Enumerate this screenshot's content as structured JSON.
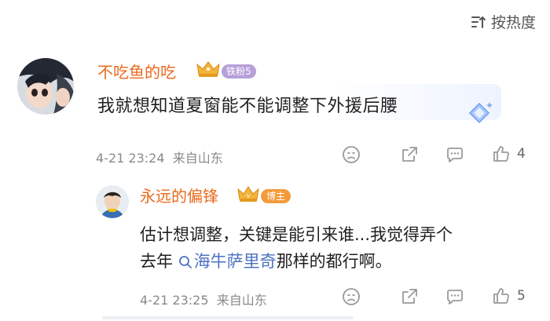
{
  "sort": {
    "label": "按热度",
    "icon": "sort-icon"
  },
  "comment": {
    "username": "不吃鱼的吃",
    "fan_badge": "铁粉5",
    "text": "我就想知道夏窗能不能调整下外援后腰",
    "time": "4-21 23:24",
    "location": "来自山东",
    "like_count": "4"
  },
  "reply": {
    "username": "永远的偏锋",
    "badge": "博主",
    "line1": "估计想调整，关键是能引来谁...我觉得弄个",
    "line2_prefix": "去年",
    "topic": "海牛萨里奇",
    "line2_suffix": "那样的都行啊。",
    "time": "4-21 23:25",
    "location": "来自山东",
    "like_count": "5"
  },
  "colors": {
    "username": "#eb6a1c",
    "topic": "#4c72c2",
    "meta": "#8a8a8a"
  }
}
